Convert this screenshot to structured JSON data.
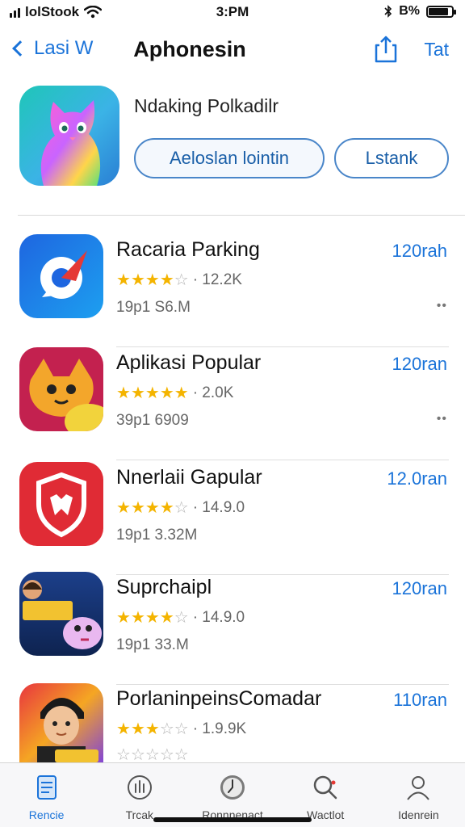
{
  "status_bar": {
    "carrier": "lolStook",
    "time": "3:PM",
    "battery": "B%"
  },
  "nav": {
    "back_label": "Lasi W",
    "title": "Aphonesin",
    "action_label": "Tat",
    "share_icon": "share-icon"
  },
  "header_app": {
    "name": "Ndaking Polkadilr",
    "install_label": "Aeloslan lointin",
    "list_label": "Lstank"
  },
  "apps": [
    {
      "name": "Racaria Parking",
      "stars": 4,
      "rating_text": "· 12.2K",
      "meta": "19p1 S6.M",
      "price": "120rah",
      "more": "••"
    },
    {
      "name": "Aplikasi Popular",
      "stars": 4.5,
      "rating_text": "· 2.0K",
      "meta": "39p1 6909",
      "price": "120ran",
      "more": "••"
    },
    {
      "name": "Nnerlaii Gapular",
      "stars": 4,
      "rating_text": "· 14.9.0",
      "meta": "19p1 3.32M",
      "price": "12.0ran",
      "more": ""
    },
    {
      "name": "Suprchaipl",
      "stars": 4,
      "rating_text": "· 14.9.0",
      "meta": "19p1 33.M",
      "price": "120ran",
      "more": ""
    },
    {
      "name": "PorlaninpeinsComadar",
      "stars": 3,
      "rating_text": "· 1.9.9K",
      "meta": "",
      "price": "110ran",
      "more": ""
    }
  ],
  "tabs": [
    {
      "label": "Rencie",
      "icon": "document-icon",
      "active": true
    },
    {
      "label": "Trcak",
      "icon": "gesture-icon",
      "active": false
    },
    {
      "label": "Ronnnenact",
      "icon": "clock-icon",
      "active": false
    },
    {
      "label": "Wactlot",
      "icon": "search-icon",
      "active": false
    },
    {
      "label": "Idenrein",
      "icon": "person-icon",
      "active": false
    }
  ],
  "colors": {
    "accent": "#1a73d9",
    "star": "#f4b400"
  }
}
